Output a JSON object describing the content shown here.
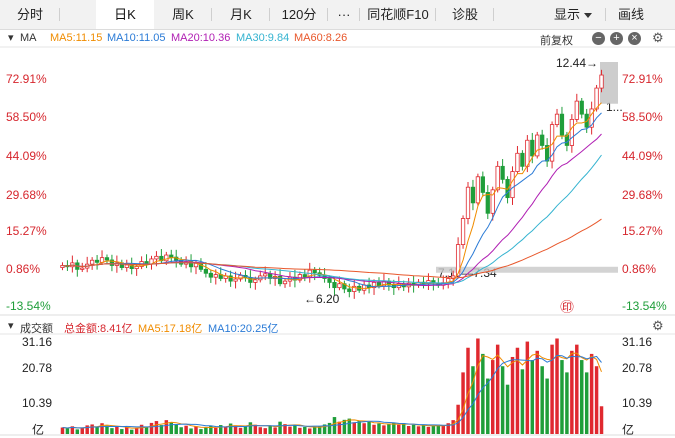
{
  "toolbar": {
    "tabs": [
      "分时",
      "日K",
      "周K",
      "月K",
      "120分",
      "···",
      "同花顺F10",
      "诊股"
    ],
    "active_tab": "日K",
    "display_label": "显示",
    "draw_label": "画线"
  },
  "indicators": {
    "main_name": "MA",
    "ma5": "MA5:11.15",
    "ma10": "MA10:11.05",
    "ma20": "MA20:10.36",
    "ma30": "MA30:9.84",
    "ma60": "MA60:8.26",
    "adjust_label": "前复权"
  },
  "colors": {
    "up": "#e0292f",
    "down": "#1f9e3a",
    "ma5": "#f08c00",
    "ma10": "#2b7bd6",
    "ma20": "#b01fb3",
    "ma30": "#34b3d0",
    "ma60": "#e8572b"
  },
  "price_axis": {
    "left_labels": [
      "72.91%",
      "58.50%",
      "44.09%",
      "29.68%",
      "15.27%",
      "0.86%",
      "-13.54%"
    ],
    "right_labels": [
      "72.91%",
      "58.50%",
      "44.09%",
      "29.68%",
      "15.27%",
      "0.86%",
      "-13.54%"
    ]
  },
  "annotations": {
    "high_label": "12.44→",
    "low_label": "←6.20",
    "range_label": "7.17—7.34",
    "right_truncated": "1...",
    "watermark": "㊞"
  },
  "volume": {
    "title": "成交额",
    "total": "总金额:8.41亿",
    "ma5": "MA5:17.18亿",
    "ma10": "MA10:20.25亿",
    "axis_labels": [
      "31.16",
      "20.78",
      "10.39"
    ],
    "unit": "亿"
  },
  "chart_data": {
    "type": "candlestick",
    "price_range_pct": [
      -13.54,
      80.0
    ],
    "grid": false,
    "candles_close_pct": [
      2.0,
      1.5,
      3.0,
      0.5,
      1.0,
      2.5,
      4.0,
      3.2,
      5.0,
      4.1,
      2.0,
      3.0,
      1.2,
      2.2,
      0.8,
      1.6,
      3.5,
      2.6,
      4.5,
      5.5,
      3.8,
      6.0,
      5.2,
      4.0,
      2.5,
      3.5,
      1.5,
      2.8,
      0.5,
      -1.0,
      -2.5,
      -1.5,
      -3.0,
      -2.0,
      -4.0,
      -3.2,
      -1.8,
      -2.6,
      -4.5,
      -3.5,
      -2.0,
      -1.2,
      -3.0,
      -2.2,
      -5.0,
      -4.0,
      -2.5,
      -3.6,
      -1.5,
      -2.4,
      0.2,
      -0.8,
      -1.8,
      -3.0,
      -4.5,
      -6.5,
      -5.0,
      -7.0,
      -8.0,
      -6.0,
      -7.5,
      -5.5,
      -6.5,
      -4.5,
      -5.8,
      -4.0,
      -5.5,
      -6.5,
      -5.0,
      -6.2,
      -4.8,
      -5.6,
      -4.4,
      -5.2,
      -3.8,
      -4.8,
      -5.6,
      -4.6,
      -3.0,
      -2.0,
      10.0,
      20.0,
      32.0,
      26.0,
      36.0,
      30.0,
      22.0,
      31.0,
      40.0,
      35.0,
      28.0,
      38.0,
      45.0,
      40.0,
      50.0,
      44.0,
      52.0,
      48.0,
      42.0,
      56.0,
      60.0,
      52.0,
      48.0,
      58.0,
      65.0,
      60.0,
      55.0,
      62.0,
      70.0,
      75.0
    ],
    "volume_values": [
      2.1,
      1.8,
      2.5,
      1.5,
      2.0,
      2.8,
      3.1,
      2.4,
      3.5,
      2.7,
      1.9,
      2.4,
      1.6,
      2.2,
      1.4,
      2.0,
      3.0,
      2.3,
      3.6,
      4.2,
      2.9,
      4.5,
      3.8,
      3.0,
      2.2,
      2.7,
      1.8,
      2.5,
      1.6,
      2.1,
      2.6,
      2.0,
      2.9,
      2.3,
      3.4,
      2.8,
      2.0,
      2.5,
      3.8,
      3.0,
      2.2,
      1.9,
      2.7,
      2.1,
      4.0,
      3.2,
      2.4,
      3.0,
      2.0,
      2.3,
      1.8,
      2.2,
      2.6,
      3.1,
      3.6,
      5.5,
      4.0,
      4.6,
      5.0,
      3.8,
      4.2,
      3.5,
      3.9,
      3.0,
      3.4,
      2.8,
      3.2,
      3.7,
      3.0,
      3.5,
      2.6,
      3.0,
      2.5,
      2.9,
      2.3,
      2.7,
      3.0,
      2.6,
      3.5,
      4.5,
      9.5,
      20.0,
      28.0,
      22.0,
      31.0,
      26.0,
      18.0,
      24.0,
      29.0,
      22.0,
      16.0,
      25.0,
      28.0,
      21.0,
      30.0,
      24.0,
      27.0,
      22.0,
      18.0,
      29.0,
      31.0,
      24.0,
      20.0,
      27.0,
      29.0,
      24.0,
      20.0,
      26.0,
      22.0,
      9.0
    ],
    "volume_range": [
      0,
      31.16
    ]
  }
}
